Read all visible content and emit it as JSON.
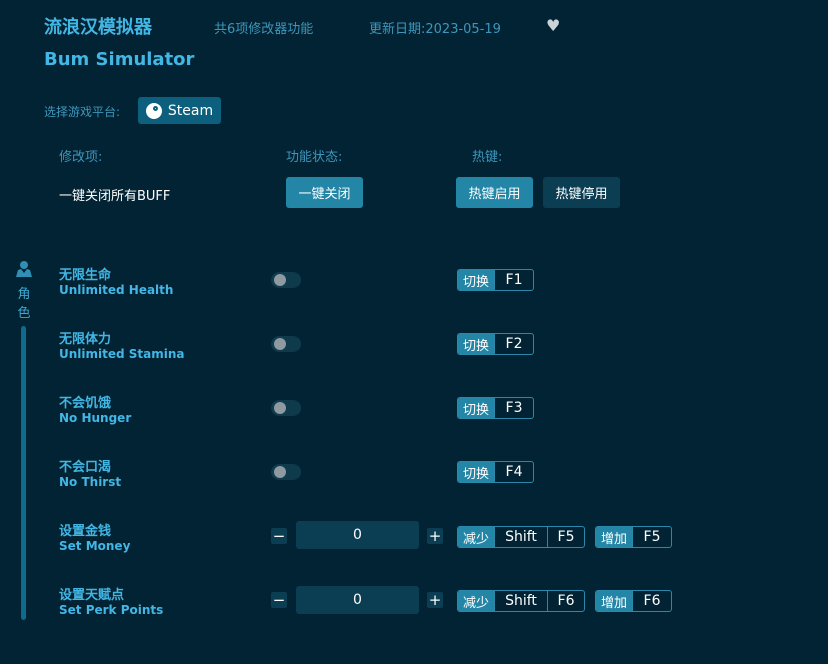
{
  "header": {
    "title_cn": "流浪汉模拟器",
    "feature_count": "共6项修改器功能",
    "update_date": "更新日期:2023-05-19",
    "favorite_icon": "heart-icon",
    "title_en": "Bum Simulator"
  },
  "platform": {
    "label": "选择游戏平台:",
    "steam_label": "Steam",
    "steam_icon": "steam-icon"
  },
  "columns": {
    "item": "修改项:",
    "status": "功能状态:",
    "hotkey": "热键:"
  },
  "global": {
    "label": "一键关闭所有BUFF",
    "close_all": "一键关闭",
    "hotkey_enable": "热键启用",
    "hotkey_disable": "热键停用"
  },
  "sidebar": {
    "category_icon": "character-icon",
    "category_label": "角色"
  },
  "toggle_rows": [
    {
      "name_cn": "无限生命",
      "name_en": "Unlimited Health",
      "enabled": false,
      "hotkey_label": "切换",
      "hotkey": "F1"
    },
    {
      "name_cn": "无限体力",
      "name_en": "Unlimited Stamina",
      "enabled": false,
      "hotkey_label": "切换",
      "hotkey": "F2"
    },
    {
      "name_cn": "不会饥饿",
      "name_en": "No Hunger",
      "enabled": false,
      "hotkey_label": "切换",
      "hotkey": "F3"
    },
    {
      "name_cn": "不会口渴",
      "name_en": "No Thirst",
      "enabled": false,
      "hotkey_label": "切换",
      "hotkey": "F4"
    }
  ],
  "value_rows": [
    {
      "name_cn": "设置金钱",
      "name_en": "Set Money",
      "value": "0",
      "minus": "−",
      "plus": "+",
      "dec_label": "减少",
      "dec_mod": "Shift",
      "dec_key": "F5",
      "inc_label": "增加",
      "inc_key": "F5"
    },
    {
      "name_cn": "设置天赋点",
      "name_en": "Set Perk Points",
      "value": "0",
      "minus": "−",
      "plus": "+",
      "dec_label": "减少",
      "dec_mod": "Shift",
      "dec_key": "F6",
      "inc_label": "增加",
      "inc_key": "F6"
    }
  ]
}
